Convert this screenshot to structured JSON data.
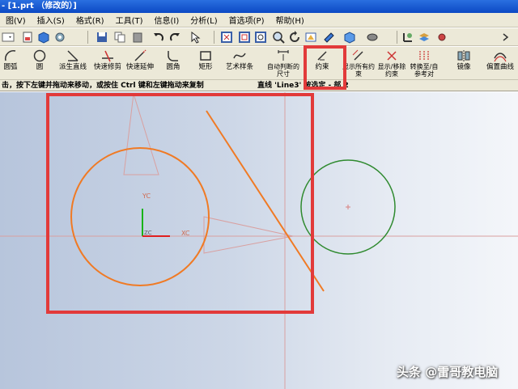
{
  "window": {
    "title": "- [1.prt （修改的）]"
  },
  "menu": [
    {
      "label": "图(V)"
    },
    {
      "label": "插入(S)"
    },
    {
      "label": "格式(R)"
    },
    {
      "label": "工具(T)"
    },
    {
      "label": "信息(I)"
    },
    {
      "label": "分析(L)"
    },
    {
      "label": "首选项(P)"
    },
    {
      "label": "帮助(H)"
    }
  ],
  "sketch_tools": [
    {
      "label": "圆弧",
      "icon": "arc-icon"
    },
    {
      "label": "圆",
      "icon": "circle-icon"
    },
    {
      "label": "派生直线",
      "icon": "derived-line-icon"
    },
    {
      "label": "快速修剪",
      "icon": "quick-trim-icon"
    },
    {
      "label": "快速延伸",
      "icon": "quick-extend-icon"
    },
    {
      "label": "圆角",
      "icon": "fillet-icon"
    },
    {
      "label": "矩形",
      "icon": "rectangle-icon"
    },
    {
      "label": "艺术样条",
      "icon": "studio-spline-icon"
    },
    {
      "label": "自动判断的尺寸",
      "icon": "inferred-dimension-icon"
    },
    {
      "label": "约束",
      "icon": "constraint-icon"
    },
    {
      "label": "显示所有约束",
      "icon": "show-all-constraints-icon"
    },
    {
      "label": "显示/移除约束",
      "icon": "show-remove-constraints-icon"
    },
    {
      "label": "转换至/自参考对",
      "icon": "convert-reference-icon"
    },
    {
      "label": "镜像",
      "icon": "mirror-icon"
    },
    {
      "label": "偏置曲线",
      "icon": "offset-curve-icon"
    }
  ],
  "status": {
    "prompt": "击，按下左键并拖动来移动，或按住 Ctrl 键和左键拖动来复制",
    "info": "直线 'Line3' 被选定 - 部 2"
  },
  "canvas": {
    "axis_labels": {
      "yc": "YC",
      "xc": "XC",
      "zc": "ZC"
    },
    "colors": {
      "orange": "#f07a24",
      "green": "#2f8a2f",
      "red_box": "#e23a3a",
      "ref_lines": "#d9a0a0"
    }
  },
  "watermark": "头条 @雷哥教电脑"
}
